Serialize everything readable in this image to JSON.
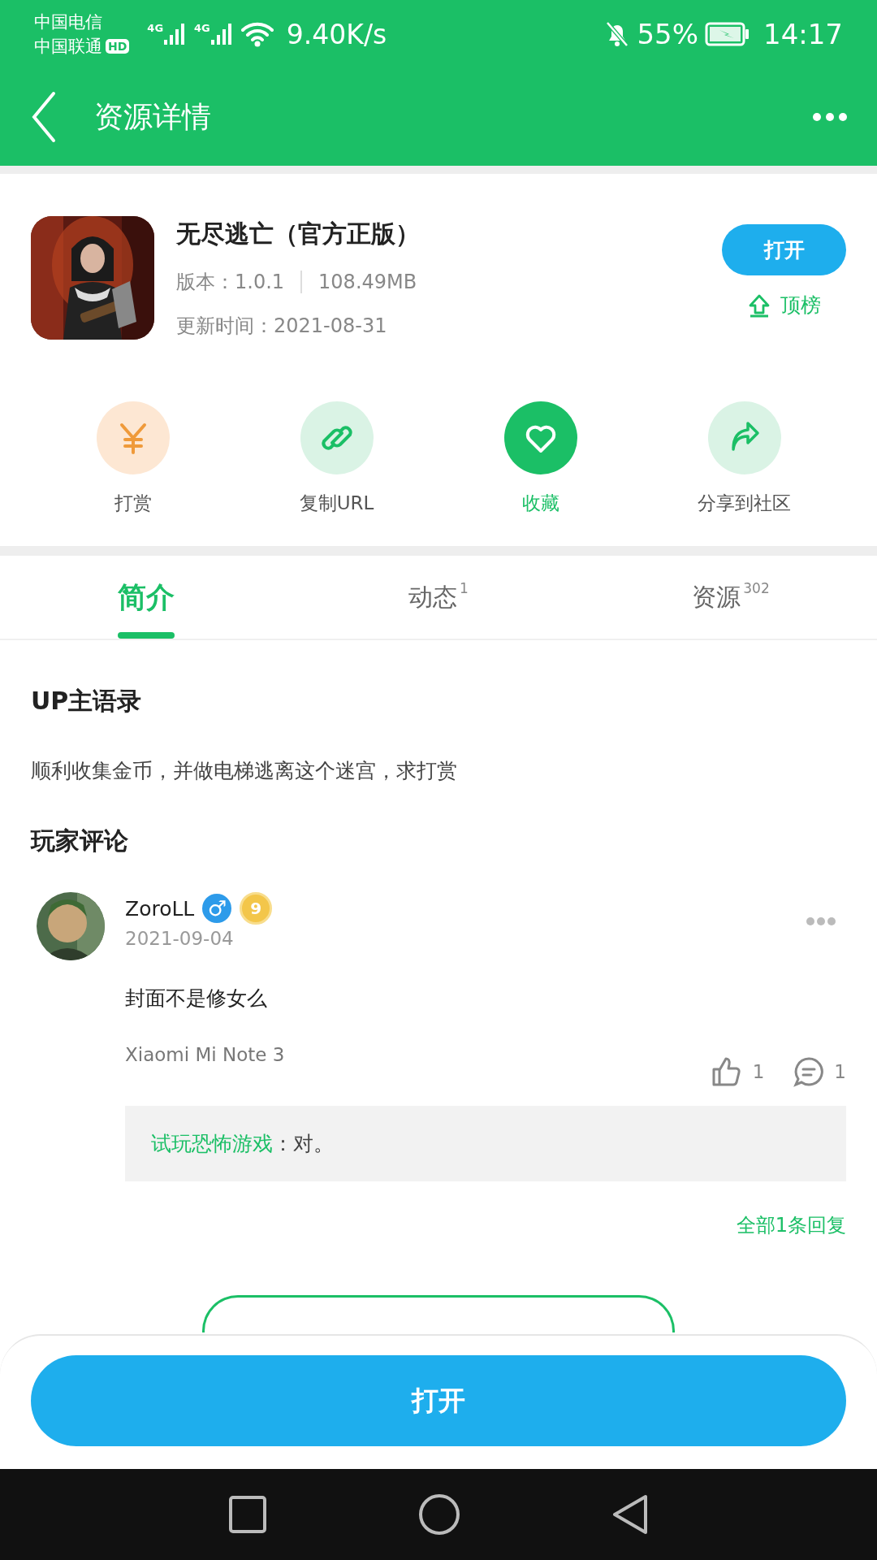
{
  "status_bar": {
    "carriers": [
      "中国电信",
      "中国联通"
    ],
    "hd_badge": "HD",
    "networks": [
      "4G",
      "4G"
    ],
    "speed": "9.40K/s",
    "battery": "55%",
    "time": "14:17"
  },
  "header": {
    "title": "资源详情"
  },
  "app": {
    "name": "无尽逃亡（官方正版）",
    "version": "版本：1.0.1",
    "size": "108.49MB",
    "updated": "更新时间：2021-08-31",
    "open_button": "打开",
    "rank_button": "顶榜"
  },
  "actions": [
    {
      "kind": "reward",
      "label": "打赏",
      "on": false
    },
    {
      "kind": "link",
      "label": "复制URL",
      "on": false
    },
    {
      "kind": "favorite",
      "label": "收藏",
      "on": true
    },
    {
      "kind": "share",
      "label": "分享到社区",
      "on": false
    }
  ],
  "tabs": [
    {
      "label": "简介",
      "selected": true
    },
    {
      "label": "动态",
      "count": "1",
      "selected": false
    },
    {
      "label": "资源",
      "count": "302",
      "selected": false
    }
  ],
  "up_quote": {
    "title": "UP主语录",
    "text": "顺利收集金币，并做电梯逃离这个迷宫，求打赏"
  },
  "comments_title": "玩家评论",
  "comments": [
    {
      "user": "ZoroLL",
      "gender": "♂",
      "level": "9",
      "date": "2021-09-04",
      "text": "封面不是修女么",
      "device": "Xiaomi Mi Note 3",
      "likes": "1",
      "replies": "1",
      "reply_author": "试玩恐怖游戏",
      "reply_text": "：对。",
      "all_replies": "全部1条回复"
    }
  ],
  "bottom_button": "打开"
}
